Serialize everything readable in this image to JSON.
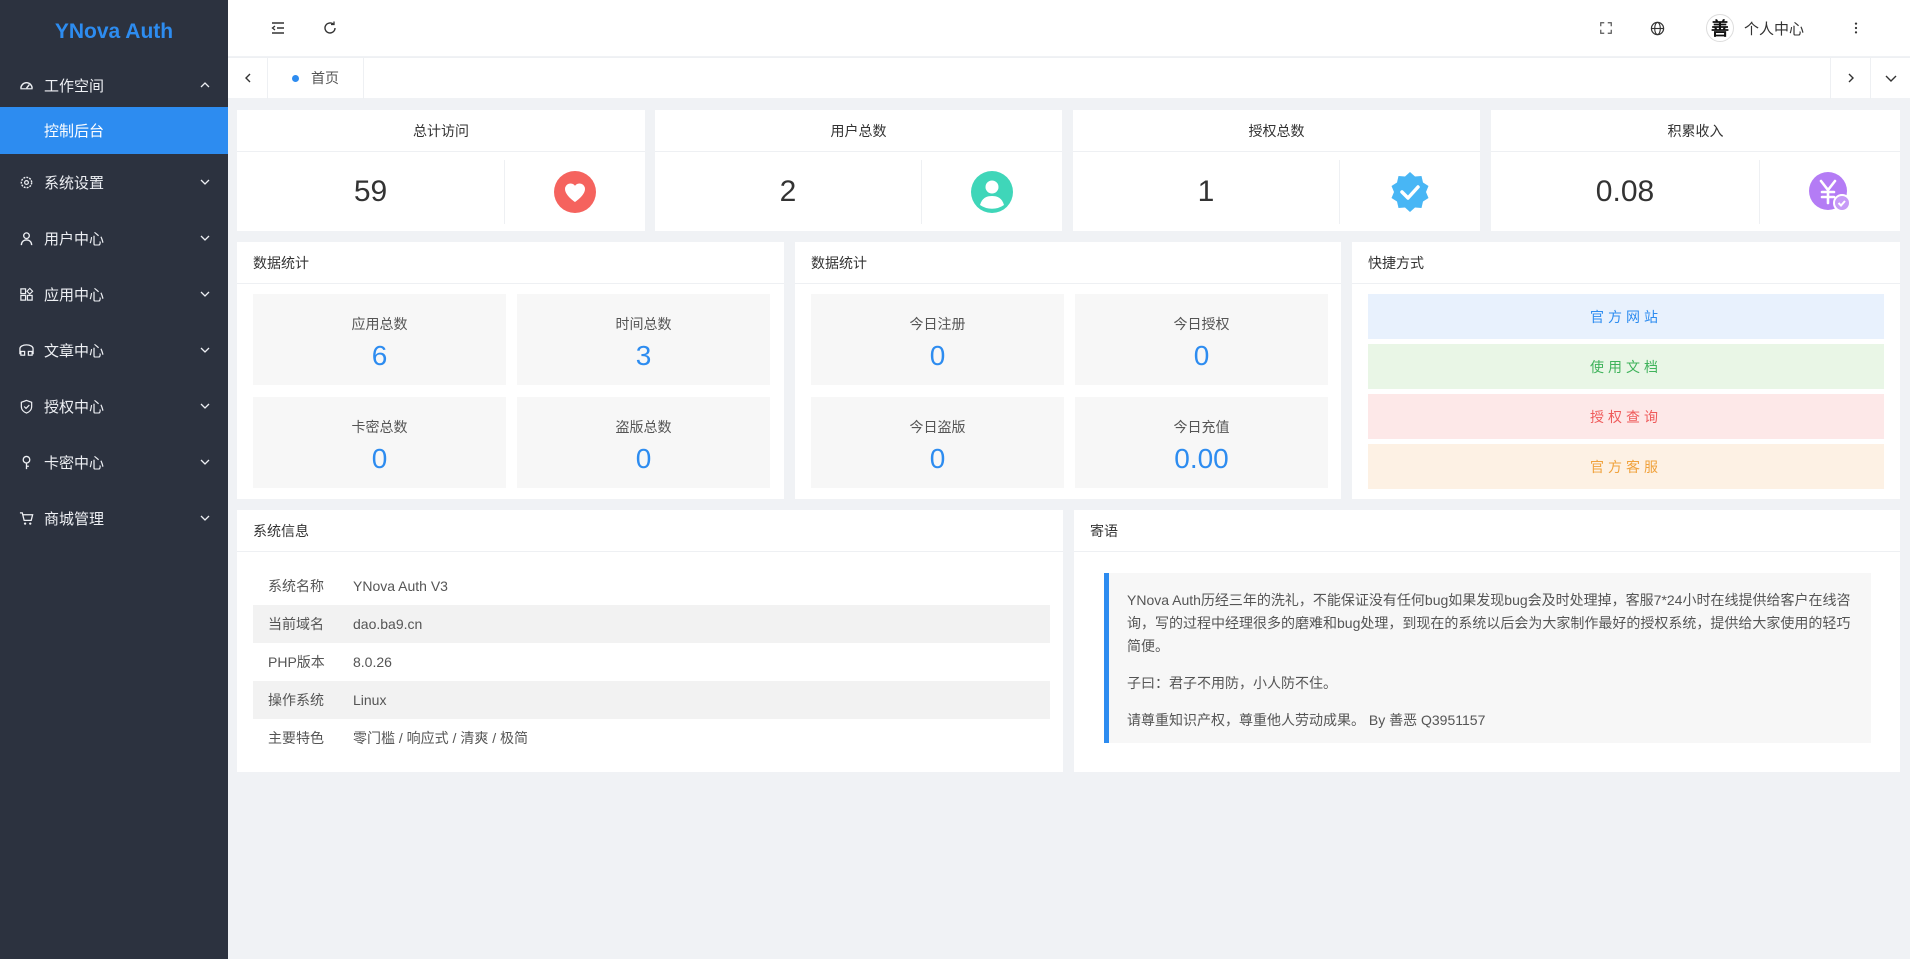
{
  "app": {
    "title": "YNova Auth"
  },
  "sidebar": {
    "items": [
      {
        "label": "工作空间",
        "icon": "dashboard-icon",
        "expanded": true
      },
      {
        "label": "系统设置",
        "icon": "settings-icon"
      },
      {
        "label": "用户中心",
        "icon": "user-icon"
      },
      {
        "label": "应用中心",
        "icon": "apps-icon"
      },
      {
        "label": "文章中心",
        "icon": "reader-icon"
      },
      {
        "label": "授权中心",
        "icon": "shield-check-icon"
      },
      {
        "label": "卡密中心",
        "icon": "key-icon"
      },
      {
        "label": "商城管理",
        "icon": "cart-icon"
      }
    ],
    "active_sub": "控制后台"
  },
  "header": {
    "user_name": "个人中心"
  },
  "tabs": [
    {
      "label": "首页",
      "active": true
    }
  ],
  "stats": [
    {
      "title": "总计访问",
      "value": "59",
      "icon": "heart-icon",
      "color": "#f5635e"
    },
    {
      "title": "用户总数",
      "value": "2",
      "icon": "person-icon",
      "color": "#3fd6b9"
    },
    {
      "title": "授权总数",
      "value": "1",
      "icon": "verified-badge-icon",
      "color": "#48b6f5"
    },
    {
      "title": "积累收入",
      "value": "0.08",
      "icon": "yuan-coin-icon",
      "color": "#b47cf5"
    }
  ],
  "data_stats_1": {
    "title": "数据统计",
    "items": [
      {
        "label": "应用总数",
        "value": "6"
      },
      {
        "label": "时间总数",
        "value": "3"
      },
      {
        "label": "卡密总数",
        "value": "0"
      },
      {
        "label": "盗版总数",
        "value": "0"
      }
    ]
  },
  "data_stats_2": {
    "title": "数据统计",
    "items": [
      {
        "label": "今日注册",
        "value": "0"
      },
      {
        "label": "今日授权",
        "value": "0"
      },
      {
        "label": "今日盗版",
        "value": "0"
      },
      {
        "label": "今日充值",
        "value": "0.00"
      }
    ]
  },
  "shortcuts": {
    "title": "快捷方式",
    "items": [
      {
        "label": "官方网站",
        "bg": "#e8f1fd",
        "color": "#2d8cf0"
      },
      {
        "label": "使用文档",
        "bg": "#e9f6e6",
        "color": "#3fb35b"
      },
      {
        "label": "授权查询",
        "bg": "#fde8e8",
        "color": "#ef5b5b"
      },
      {
        "label": "官方客服",
        "bg": "#fdf1e4",
        "color": "#f0a23d"
      }
    ]
  },
  "system_info": {
    "title": "系统信息",
    "rows": [
      {
        "key": "系统名称",
        "value": "YNova Auth V3"
      },
      {
        "key": "当前域名",
        "value": "dao.ba9.cn"
      },
      {
        "key": "PHP版本",
        "value": "8.0.26"
      },
      {
        "key": "操作系统",
        "value": "Linux"
      },
      {
        "key": "主要特色",
        "value": "零门槛 / 响应式 / 清爽 / 极简"
      }
    ]
  },
  "message": {
    "title": "寄语",
    "paragraphs": [
      "YNova Auth历经三年的洗礼，不能保证没有任何bug如果发现bug会及时处理掉，客服7*24小时在线提供给客户在线咨询，写的过程中经理很多的磨难和bug处理，到现在的系统以后会为大家制作最好的授权系统，提供给大家使用的轻巧简便。",
      "子曰：君子不用防，小人防不住。",
      "请尊重知识产权，尊重他人劳动成果。 By 善恶 Q3951157"
    ]
  }
}
